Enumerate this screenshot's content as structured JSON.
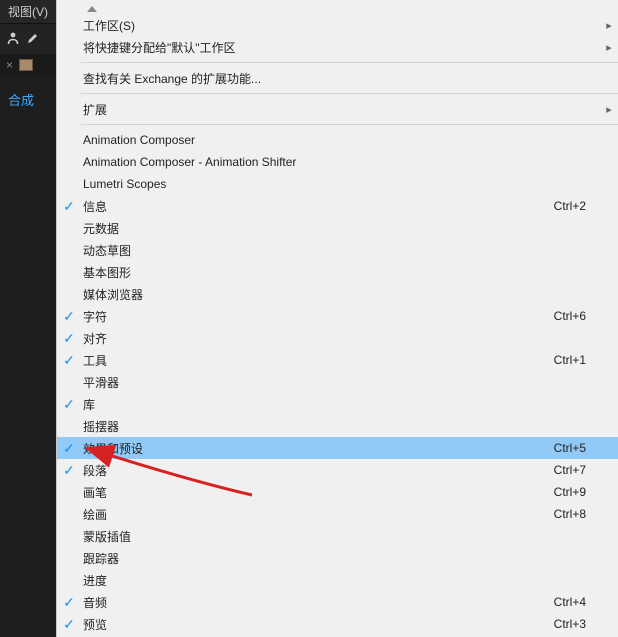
{
  "leftPanel": {
    "menuLabel": "视图(V)",
    "panelLabel": "合成",
    "tabClose": "×"
  },
  "icons": {
    "submenu": "▸",
    "check": "✓"
  },
  "menu": [
    {
      "type": "top-arrow"
    },
    {
      "type": "item",
      "label": "工作区(S)",
      "submenu": true
    },
    {
      "type": "item",
      "label": "将快捷键分配给\"默认\"工作区",
      "submenu": true
    },
    {
      "type": "separator"
    },
    {
      "type": "item",
      "label": "查找有关 Exchange 的扩展功能..."
    },
    {
      "type": "separator"
    },
    {
      "type": "item",
      "label": "扩展",
      "submenu": true
    },
    {
      "type": "separator"
    },
    {
      "type": "item",
      "label": "Animation Composer"
    },
    {
      "type": "item",
      "label": "Animation Composer - Animation Shifter"
    },
    {
      "type": "item",
      "label": "Lumetri Scopes"
    },
    {
      "type": "item",
      "label": "信息",
      "checked": true,
      "shortcut": "Ctrl+2"
    },
    {
      "type": "item",
      "label": "元数据"
    },
    {
      "type": "item",
      "label": "动态草图"
    },
    {
      "type": "item",
      "label": "基本图形"
    },
    {
      "type": "item",
      "label": "媒体浏览器"
    },
    {
      "type": "item",
      "label": "字符",
      "checked": true,
      "shortcut": "Ctrl+6"
    },
    {
      "type": "item",
      "label": "对齐",
      "checked": true
    },
    {
      "type": "item",
      "label": "工具",
      "checked": true,
      "shortcut": "Ctrl+1"
    },
    {
      "type": "item",
      "label": "平滑器"
    },
    {
      "type": "item",
      "label": "库",
      "checked": true
    },
    {
      "type": "item",
      "label": "摇摆器"
    },
    {
      "type": "item",
      "label": "效果和预设",
      "checked": true,
      "shortcut": "Ctrl+5",
      "selected": true
    },
    {
      "type": "item",
      "label": "段落",
      "checked": true,
      "shortcut": "Ctrl+7"
    },
    {
      "type": "item",
      "label": "画笔",
      "shortcut": "Ctrl+9"
    },
    {
      "type": "item",
      "label": "绘画",
      "shortcut": "Ctrl+8"
    },
    {
      "type": "item",
      "label": "蒙版插值"
    },
    {
      "type": "item",
      "label": "跟踪器"
    },
    {
      "type": "item",
      "label": "进度"
    },
    {
      "type": "item",
      "label": "音频",
      "checked": true,
      "shortcut": "Ctrl+4"
    },
    {
      "type": "item",
      "label": "预览",
      "checked": true,
      "shortcut": "Ctrl+3"
    }
  ]
}
